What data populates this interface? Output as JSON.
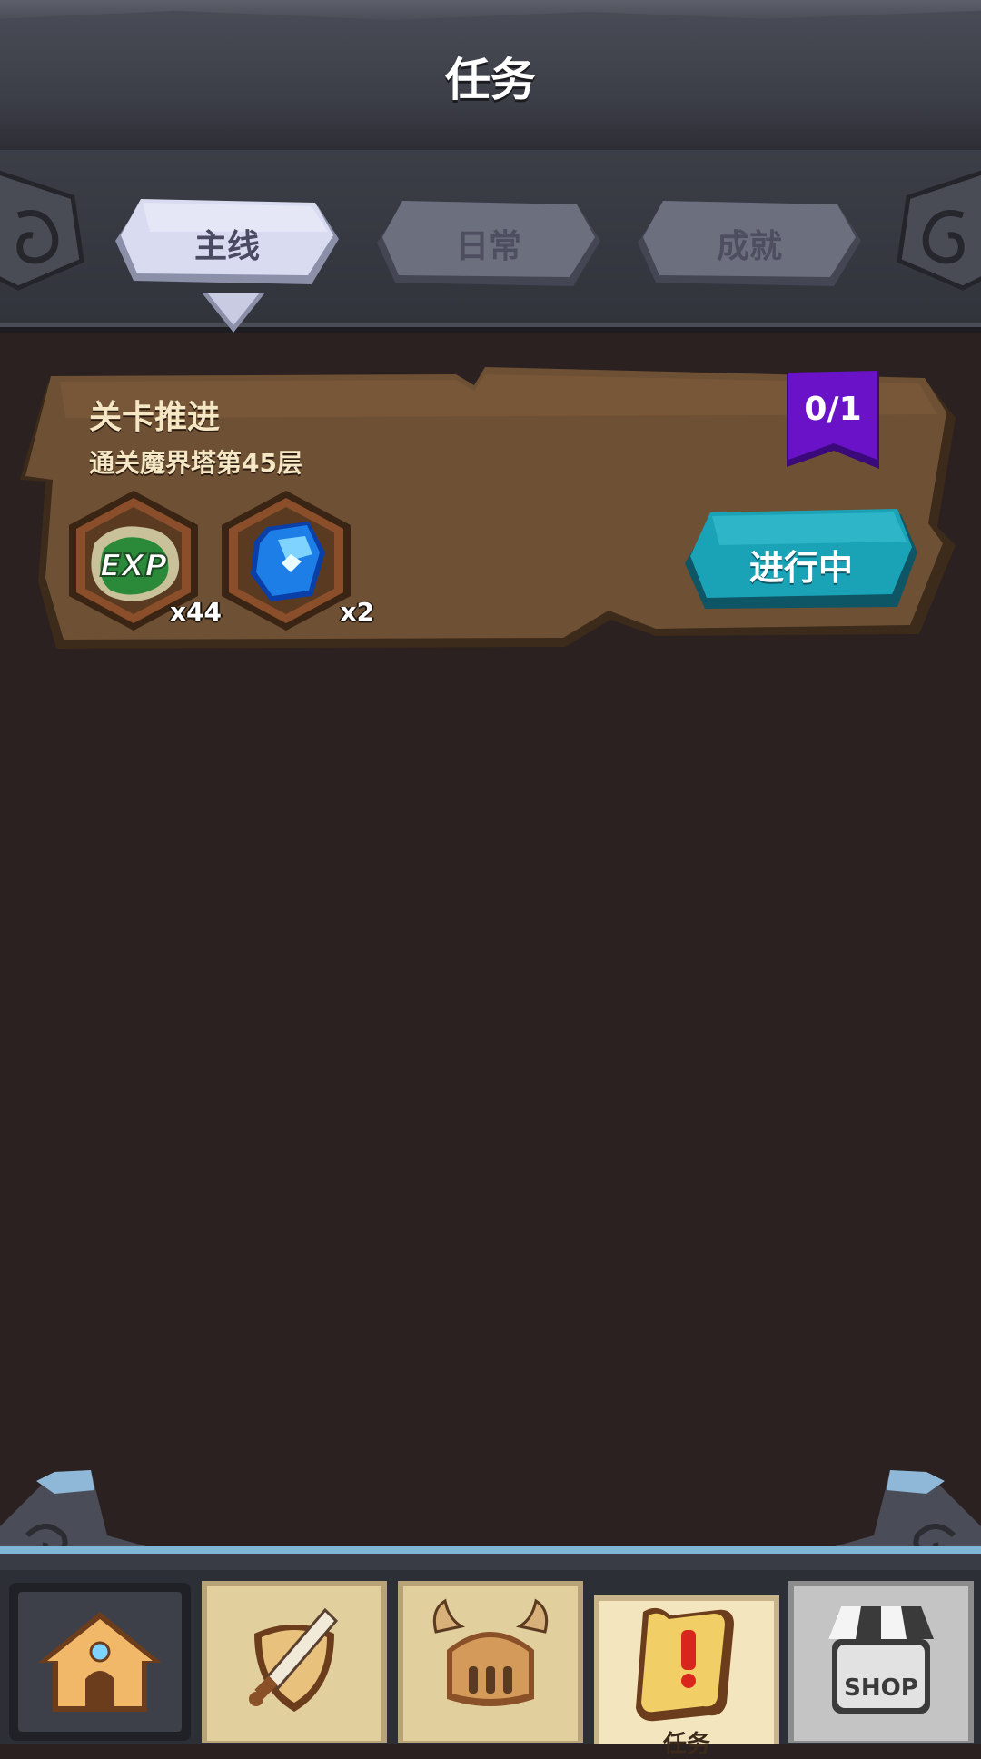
{
  "header": {
    "title": "任务"
  },
  "tabs": [
    {
      "label": "主线",
      "active": true
    },
    {
      "label": "日常",
      "active": false
    },
    {
      "label": "成就",
      "active": false
    }
  ],
  "mission": {
    "title": "关卡推进",
    "description": "通关魔界塔第45层",
    "progress": "0/1",
    "rewards": [
      {
        "icon": "exp-icon",
        "badge": "EXP",
        "quantity": "x44"
      },
      {
        "icon": "blue-gem-icon",
        "quantity": "x2"
      }
    ],
    "status_button": "进行中"
  },
  "bottom_nav": [
    {
      "icon": "home-icon",
      "label": "",
      "state": "dark"
    },
    {
      "icon": "sword-shield-icon",
      "label": "",
      "state": "normal"
    },
    {
      "icon": "helmet-icon",
      "label": "",
      "state": "normal"
    },
    {
      "icon": "quest-scroll-icon",
      "label": "任务",
      "state": "selected"
    },
    {
      "icon": "shop-icon",
      "label": "",
      "badge": "SHOP",
      "state": "grey"
    }
  ],
  "colors": {
    "background": "#2b2120",
    "card": "#6e5034",
    "progress_flag": "#6a12c8",
    "status_button": "#1aa2b6",
    "tab_active": "#d6d8ee",
    "tab_inactive": "#6c6f7e"
  }
}
